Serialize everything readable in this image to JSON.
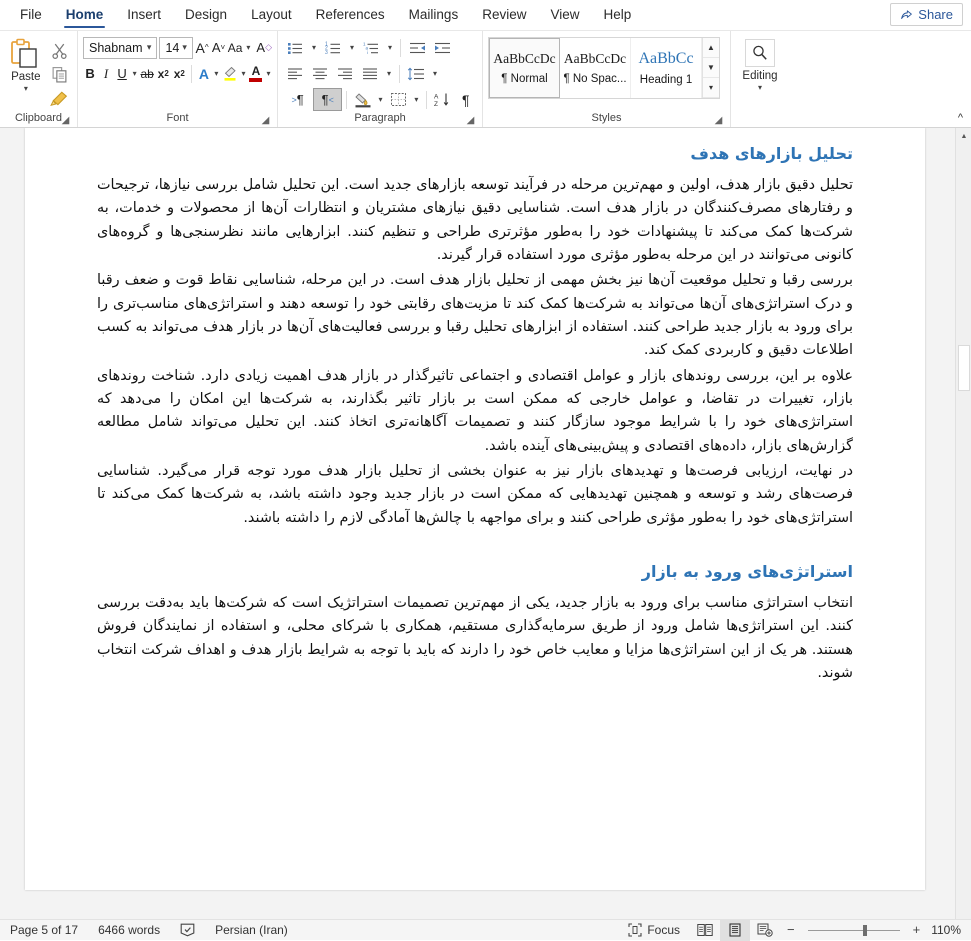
{
  "window": {
    "share_label": "Share"
  },
  "tabs": [
    {
      "label": "File",
      "active": false
    },
    {
      "label": "Home",
      "active": true
    },
    {
      "label": "Insert",
      "active": false
    },
    {
      "label": "Design",
      "active": false
    },
    {
      "label": "Layout",
      "active": false
    },
    {
      "label": "References",
      "active": false
    },
    {
      "label": "Mailings",
      "active": false
    },
    {
      "label": "Review",
      "active": false
    },
    {
      "label": "View",
      "active": false
    },
    {
      "label": "Help",
      "active": false
    }
  ],
  "ribbon": {
    "clipboard": {
      "group_label": "Clipboard",
      "paste_label": "Paste",
      "cut_icon": "scissors-icon",
      "copy_icon": "copy-icon",
      "format_painter_icon": "format-painter-icon"
    },
    "font": {
      "group_label": "Font",
      "font_name": "Shabnam",
      "font_size": "14",
      "bold_label": "B",
      "italic_label": "I",
      "underline_label": "U",
      "strikethrough_label": "ab",
      "subscript_label": "x",
      "superscript_label": "x",
      "grow_font_label": "A",
      "shrink_font_label": "A",
      "change_case_label": "Aa",
      "clear_formatting_label": "A",
      "text_effects_label": "A",
      "highlight_label": "highlight-icon",
      "font_color_label": "A"
    },
    "paragraph": {
      "group_label": "Paragraph",
      "bullets_icon": "bullet-list-icon",
      "numbering_icon": "numbered-list-icon",
      "multilevel_icon": "multilevel-list-icon",
      "decrease_indent_icon": "decrease-indent-icon",
      "increase_indent_icon": "increase-indent-icon",
      "align_left_icon": "align-left-icon",
      "align_center_icon": "align-center-icon",
      "align_right_icon": "align-right-icon",
      "justify_icon": "justify-icon",
      "line_spacing_icon": "line-spacing-icon",
      "ltr_icon": "text-direction-ltr-icon",
      "rtl_icon": "text-direction-rtl-icon",
      "rtl_active": true,
      "shading_icon": "shading-icon",
      "borders_icon": "borders-icon",
      "sort_icon": "sort-az-icon",
      "show_marks_icon": "pilcrow-icon"
    },
    "styles": {
      "group_label": "Styles",
      "items": [
        {
          "preview": "AaBbCcDc",
          "name": "¶ Normal",
          "selected": true,
          "heading": false
        },
        {
          "preview": "AaBbCcDc",
          "name": "¶ No Spac...",
          "selected": false,
          "heading": false
        },
        {
          "preview": "AaBbCc",
          "name": "Heading 1",
          "selected": false,
          "heading": true
        }
      ]
    },
    "editing": {
      "group_label": "",
      "label": "Editing",
      "icon": "magnifier-icon"
    },
    "collapse_icon": "chevron-up-icon"
  },
  "document": {
    "blocks": [
      {
        "type": "heading",
        "text": "تحلیل بازارهای هدف"
      },
      {
        "type": "paragraph",
        "text": "تحلیل دقیق بازار هدف، اولین و مهم‌ترین مرحله در فرآیند توسعه بازارهای جدید است. این تحلیل شامل بررسی نیازها، ترجیحات و رفتارهای مصرف‌کنندگان در بازار هدف است. شناسایی دقیق نیازهای مشتریان و انتظارات آن‌ها از محصولات و خدمات، به شرکت‌ها کمک می‌کند تا پیشنهادات خود را به‌طور مؤثرتری طراحی و تنظیم کنند. ابزارهایی مانند نظرسنجی‌ها و گروه‌های کانونی می‌توانند در این مرحله به‌طور مؤثری مورد استفاده قرار گیرند."
      },
      {
        "type": "paragraph",
        "text": "بررسی رقبا و تحلیل موقعیت آن‌ها نیز بخش مهمی از تحلیل بازار هدف است. در این مرحله، شناسایی نقاط قوت و ضعف رقبا و درک استراتژی‌های آن‌ها می‌تواند به شرکت‌ها کمک کند تا مزیت‌های رقابتی خود را توسعه دهند و استراتژی‌های مناسب‌تری را برای ورود به بازار جدید طراحی کنند. استفاده از ابزارهای تحلیل رقبا و بررسی فعالیت‌های آن‌ها در بازار هدف می‌تواند به کسب اطلاعات دقیق و کاربردی کمک کند."
      },
      {
        "type": "paragraph",
        "text": "علاوه بر این، بررسی روندهای بازار و عوامل اقتصادی و اجتماعی تاثیرگذار در بازار هدف اهمیت زیادی دارد. شناخت روندهای بازار، تغییرات در تقاضا، و عوامل خارجی که ممکن است بر بازار تاثیر بگذارند، به شرکت‌ها این امکان را می‌دهد که استراتژی‌های خود را با شرایط موجود سازگار کنند و تصمیمات آگاهانه‌تری اتخاذ کنند. این تحلیل می‌تواند شامل مطالعه گزارش‌های بازار، داده‌های اقتصادی و پیش‌بینی‌های آینده باشد."
      },
      {
        "type": "paragraph",
        "text": "در نهایت، ارزیابی فرصت‌ها و تهدیدهای بازار نیز به عنوان بخشی از تحلیل بازار هدف مورد توجه قرار می‌گیرد. شناسایی فرصت‌های رشد و توسعه و همچنین تهدیدهایی که ممکن است در بازار جدید وجود داشته باشد، به شرکت‌ها کمک می‌کند تا استراتژی‌های خود را به‌طور مؤثری طراحی کنند و برای مواجهه با چالش‌ها آمادگی لازم را داشته باشند."
      },
      {
        "type": "heading2",
        "text": "استراتژی‌های ورود به بازار"
      },
      {
        "type": "paragraph",
        "text": "انتخاب استراتژی مناسب برای ورود به بازار جدید، یکی از مهم‌ترین تصمیمات استراتژیک است که شرکت‌ها باید به‌دقت بررسی کنند. این استراتژی‌ها شامل ورود از طریق سرمایه‌گذاری مستقیم، همکاری با شرکای محلی، و استفاده از نمایندگان فروش هستند. هر یک از این استراتژی‌ها مزایا و معایب خاص خود را دارند که باید با توجه به شرایط بازار هدف و اهداف شرکت انتخاب شوند."
      }
    ]
  },
  "statusbar": {
    "page_info": "Page 5 of 17",
    "word_count": "6466 words",
    "proofing_icon": "proofing-errors-icon",
    "language": "Persian (Iran)",
    "focus_label": "Focus",
    "focus_icon": "focus-icon",
    "view_read_icon": "read-mode-icon",
    "view_print_icon": "print-layout-icon",
    "view_web_icon": "web-layout-icon",
    "zoom_out": "−",
    "zoom_in": "+",
    "zoom_level": "110%"
  },
  "colors": {
    "accent": "#2b579a",
    "heading": "#2e74b5",
    "highlight": "#ffff00",
    "font_color": "#c00000"
  }
}
